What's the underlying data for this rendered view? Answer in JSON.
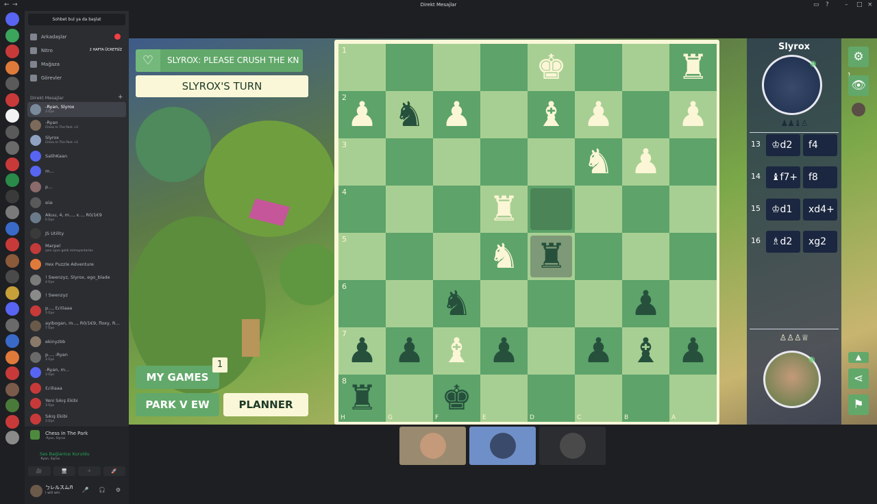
{
  "window": {
    "title": "Direkt Mesajlar"
  },
  "sidebar": {
    "search_placeholder": "Sohbet bul ya da başlat",
    "nav": [
      {
        "label": "Arkadaşlar",
        "icon": "friends-icon",
        "badge": "1"
      },
      {
        "label": "Nitro",
        "icon": "nitro-icon",
        "pill": "2 HAFTA ÜCRETSİZ"
      },
      {
        "label": "Mağaza",
        "icon": "shop-icon"
      },
      {
        "label": "Görevler",
        "icon": "quests-icon"
      }
    ],
    "dm_header": "Direkt Mesajlar",
    "dms": [
      {
        "name": "-Ryan, Slyrox",
        "sub": "3 Üye",
        "color": "#7a8a9a"
      },
      {
        "name": "-Ryan",
        "sub": "Chess In The Park +2",
        "color": "#7c6a5a"
      },
      {
        "name": "Slyrox",
        "sub": "Chess In The Park +1",
        "color": "#8fa2c0"
      },
      {
        "name": "SalihKaan",
        "sub": "",
        "color": "#5865f2"
      },
      {
        "name": "m...",
        "sub": "",
        "color": "#5865f2"
      },
      {
        "name": "p...",
        "sub": "",
        "color": "#8a6a6a"
      },
      {
        "name": "ʚϊɞ",
        "sub": "",
        "color": "#5a5a5a"
      },
      {
        "name": "Akuu, 4, m..., x..., R0/1€9",
        "sub": "6 Üye",
        "color": "#6a7a8a"
      },
      {
        "name": "JS Utility",
        "sub": "",
        "color": "#3a3a3a"
      },
      {
        "name": "Marpel",
        "sub": "yeni oyun geldi mimayentarlas",
        "color": "#c23a3a"
      },
      {
        "name": "Hex Puzzle Adventure",
        "sub": "",
        "color": "#e07a3a"
      },
      {
        "name": "! Swenzyz, Slyrox, ego_blade",
        "sub": "4 Üye",
        "color": "#7a7a7a"
      },
      {
        "name": "! Swenzyz",
        "sub": "",
        "color": "#8a8a8a"
      },
      {
        "name": "p..., Ɛɾiliaaa",
        "sub": "3 Üye",
        "color": "#c83a3a"
      },
      {
        "name": "ayibogan, m..., R0/1€9, floxy, R...",
        "sub": "7 Üye",
        "color": "#6a5a4a"
      },
      {
        "name": "ekinyzbb",
        "sub": "",
        "color": "#8a7a6a"
      },
      {
        "name": "p..., -Ryan",
        "sub": "3 Üye",
        "color": "#6a6a6a"
      },
      {
        "name": "-Ryan, m...",
        "sub": "3 Üye",
        "color": "#5865f2"
      },
      {
        "name": "Ɛɾiliaaa",
        "sub": "",
        "color": "#c83a3a"
      },
      {
        "name": "Yeni Sıkış Ekibi",
        "sub": "3 Üye",
        "color": "#c83a3a"
      },
      {
        "name": "Sıkış Ekibi",
        "sub": "3 Üye",
        "color": "#c83a3a"
      }
    ],
    "voice": {
      "channel": "Chess In The Park",
      "channel_sub": "-Ryan, Slyrox",
      "status": "Ses Bağlantısı Kuruldu",
      "status_sub": "-Ryan, Slyrox",
      "buttons": [
        "🎥",
        "🖥",
        "⁘",
        "🚀"
      ]
    },
    "user": {
      "name": "ㄅレルスムЛ",
      "status": "I will win",
      "controls": "🎤 🎧 ⚙"
    }
  },
  "game": {
    "caption": "SLYROX: PLEASE CRUSH THE KN GHT",
    "turn": "SLYROX'S TURN",
    "my_games": "MY GAMES",
    "my_games_badge": "1",
    "park_view": "PARK V EW",
    "planner": "PLANNER",
    "board": {
      "ranks": [
        "1",
        "2",
        "3",
        "4",
        "5",
        "6",
        "7",
        "8"
      ],
      "files": [
        "H",
        "G",
        "F",
        "E",
        "D",
        "C",
        "B",
        "A"
      ],
      "rows": [
        [
          "",
          "",
          "",
          "",
          "WK",
          "",
          "",
          "WR"
        ],
        [
          "WP",
          "BN",
          "WP",
          "",
          "WB",
          "WP",
          "",
          "WP"
        ],
        [
          "",
          "",
          "",
          "",
          "",
          "WN",
          "WP",
          ""
        ],
        [
          "",
          "",
          "",
          "WR",
          "",
          "",
          "",
          ""
        ],
        [
          "",
          "",
          "",
          "WN",
          "BR",
          "",
          "",
          ""
        ],
        [
          "",
          "",
          "BN",
          "",
          "",
          "",
          "BP",
          ""
        ],
        [
          "BP",
          "BP",
          "WB",
          "BP",
          "",
          "BP",
          "BB",
          "BP"
        ],
        [
          "BR",
          "",
          "BK",
          "",
          "",
          "",
          "",
          ""
        ]
      ],
      "highlight": [
        {
          "r": 3,
          "c": 4
        },
        {
          "r": 4,
          "c": 4,
          "alt": true
        }
      ]
    },
    "top_player": {
      "name": "Slyrox",
      "captured": "♟♟♝♙"
    },
    "moves": [
      {
        "n": "13",
        "a": "♔d2",
        "b": "f4"
      },
      {
        "n": "14",
        "a": "♝f7+",
        "b": "f8"
      },
      {
        "n": "15",
        "a": "♔d1",
        "b": "xd4+"
      },
      {
        "n": "16",
        "a": "♗d2",
        "b": "xg2"
      }
    ],
    "bottom_player": {
      "captured": "♙♙♙♕"
    },
    "side_buttons": [
      "⚙",
      "👁",
      "▲",
      "⋖",
      "⚑"
    ],
    "side_badge": "1"
  }
}
